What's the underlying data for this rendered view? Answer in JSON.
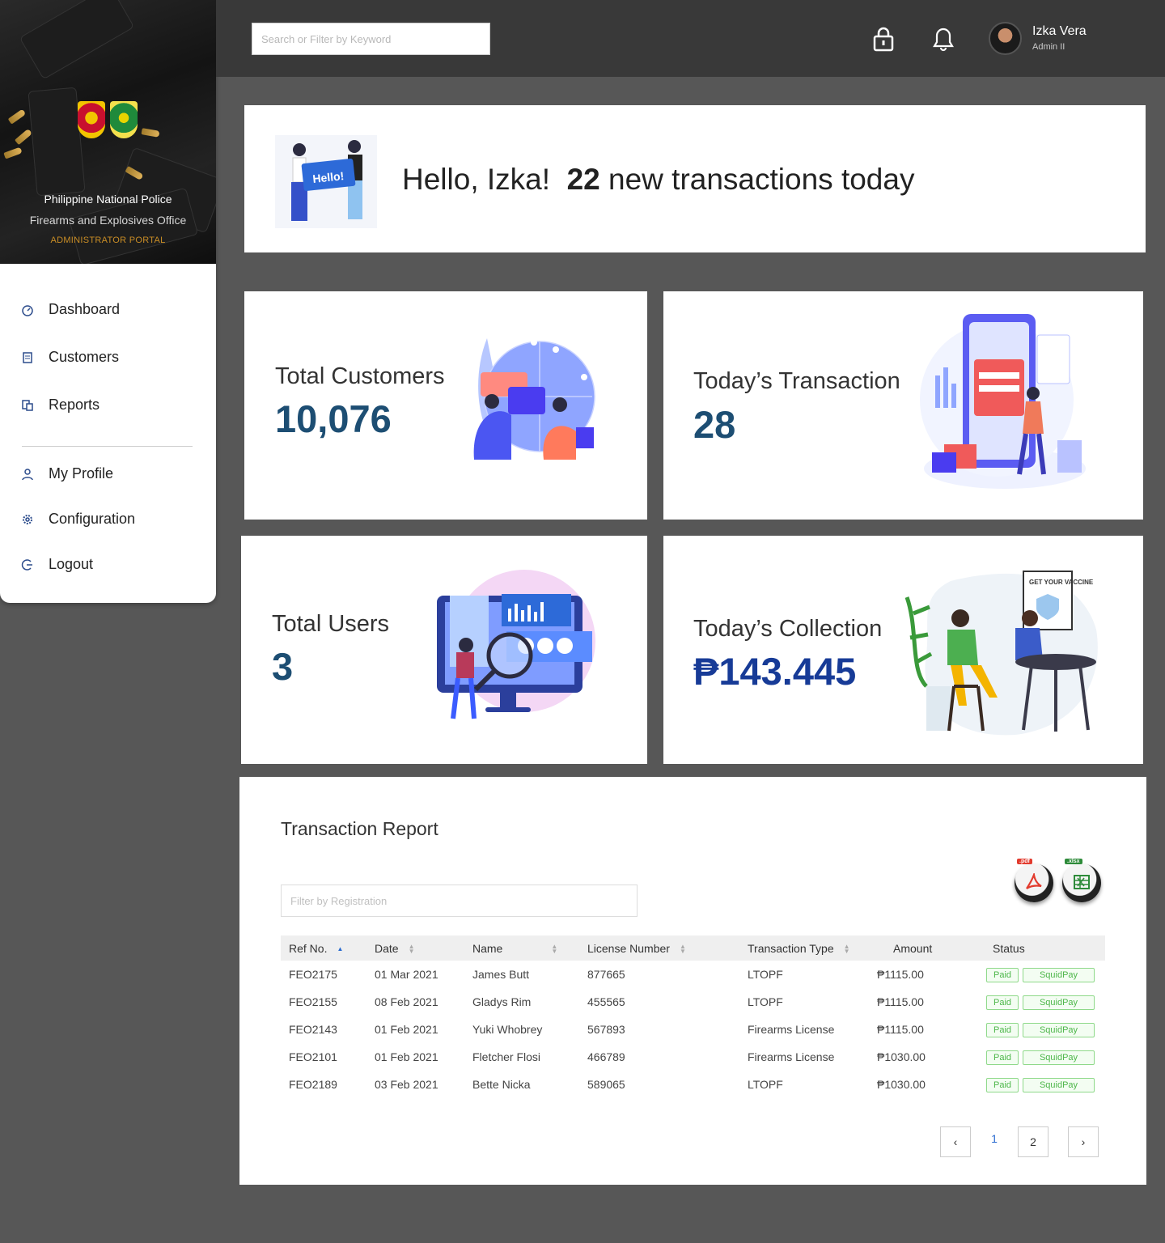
{
  "sidebar": {
    "org_title": "Philippine National Police",
    "org_subtitle": "Firearms and Explosives Office",
    "portal": "ADMINISTRATOR PORTAL",
    "items": [
      {
        "label": "Dashboard",
        "icon": "dashboard-icon"
      },
      {
        "label": "Customers",
        "icon": "document-icon"
      },
      {
        "label": "Reports",
        "icon": "report-icon"
      },
      {
        "label": "My Profile",
        "icon": "user-icon"
      },
      {
        "label": "Configuration",
        "icon": "gear-icon"
      },
      {
        "label": "Logout",
        "icon": "logout-icon"
      }
    ]
  },
  "topbar": {
    "search_placeholder": "Search or Filter by Keyword",
    "user_name": "Izka Vera",
    "user_role": "Admin II"
  },
  "hello": {
    "greeting": "Hello, Izka!",
    "count": "22",
    "suffix": "new transactions today",
    "illustration_text": "Hello!"
  },
  "stats": {
    "customers": {
      "label": "Total Customers",
      "value": "10,076"
    },
    "transactions": {
      "label": "Today’s Transaction",
      "value": "28"
    },
    "users": {
      "label": "Total Users",
      "value": "3"
    },
    "collection": {
      "label": "Today’s Collection",
      "value": "₱143.445"
    }
  },
  "vaccine_poster": "GET YOUR VACCINE",
  "report": {
    "title": "Transaction Report",
    "filter_placeholder": "Filter by Registration",
    "export_pdf": ".pdf",
    "export_xlsx": ".xlsx",
    "columns": [
      "Ref No.",
      "Date",
      "Name",
      "License Number",
      "Transaction Type",
      "Amount",
      "Status"
    ],
    "rows": [
      {
        "ref": "FEO2175",
        "date": "01 Mar 2021",
        "name": "James  Butt",
        "license": "877665",
        "type": "LTOPF",
        "amount": "₱1115.00",
        "status": "Paid",
        "method": "SquidPay"
      },
      {
        "ref": "FEO2155",
        "date": "08  Feb 2021",
        "name": "Gladys Rim",
        "license": "455565",
        "type": "LTOPF",
        "amount": "₱1115.00",
        "status": "Paid",
        "method": "SquidPay"
      },
      {
        "ref": "FEO2143",
        "date": "01 Feb 2021",
        "name": "Yuki Whobrey",
        "license": "567893",
        "type": "Firearms License",
        "amount": "₱1115.00",
        "status": "Paid",
        "method": "SquidPay"
      },
      {
        "ref": "FEO2101",
        "date": "01 Feb 2021",
        "name": "Fletcher Flosi",
        "license": "466789",
        "type": "Firearms License",
        "amount": "₱1030.00",
        "status": "Paid",
        "method": "SquidPay"
      },
      {
        "ref": "FEO2189",
        "date": "03 Feb 2021",
        "name": "Bette Nicka",
        "license": "589065",
        "type": "LTOPF",
        "amount": "₱1030.00",
        "status": "Paid",
        "method": "SquidPay"
      }
    ],
    "pagination": {
      "prev": "‹",
      "pages": [
        "1",
        "2"
      ],
      "next": "›",
      "current": "1"
    }
  },
  "colors": {
    "accent": "#1d4e73",
    "collection": "#173b97",
    "paid_green": "#4db74a",
    "topbar": "#393939",
    "page_bg": "#575757"
  }
}
